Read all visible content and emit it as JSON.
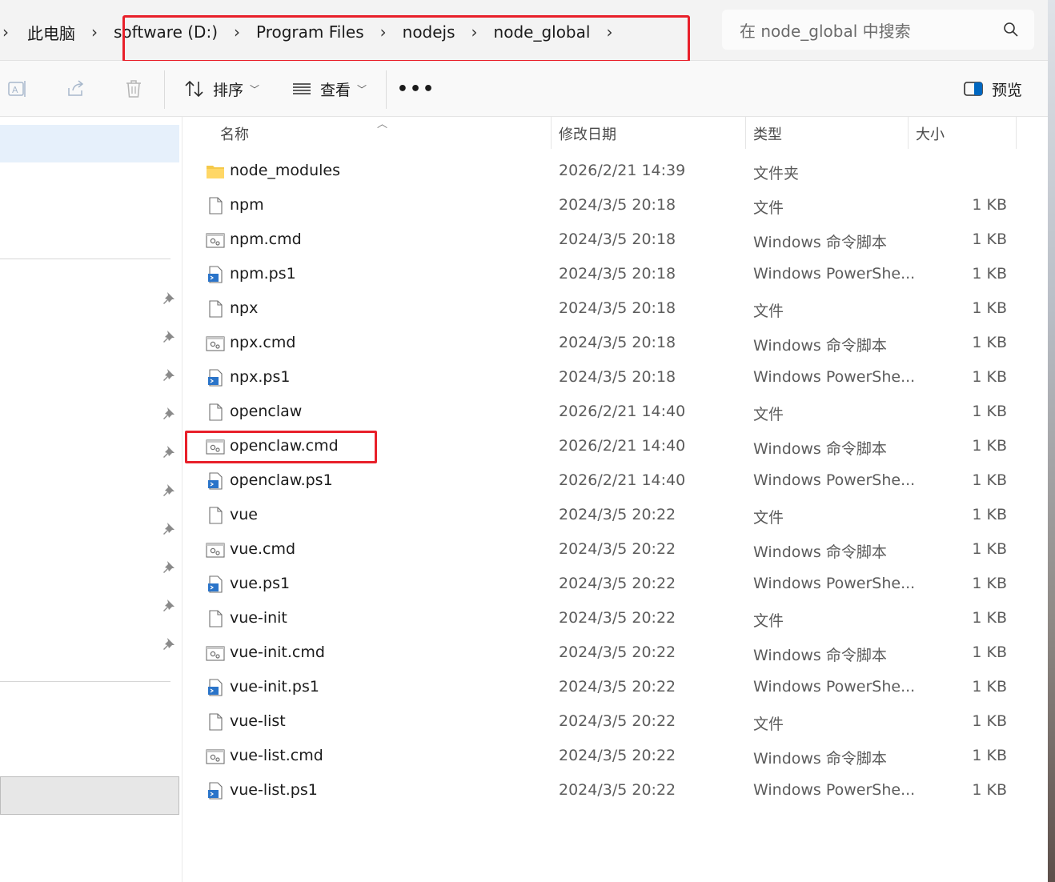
{
  "breadcrumb": {
    "items": [
      "此电脑",
      "software (D:)",
      "Program Files",
      "nodejs",
      "node_global"
    ]
  },
  "search": {
    "placeholder": "在 node_global 中搜索"
  },
  "toolbar": {
    "sort_label": "排序",
    "view_label": "查看",
    "more_label": "•••",
    "preview_label": "预览"
  },
  "columns": {
    "name": "名称",
    "date": "修改日期",
    "type": "类型",
    "size": "大小"
  },
  "files": [
    {
      "name": "node_modules",
      "date": "2026/2/21 14:39",
      "type": "文件夹",
      "size": "",
      "icon": "folder-icon"
    },
    {
      "name": "npm",
      "date": "2024/3/5 20:18",
      "type": "文件",
      "size": "1 KB",
      "icon": "file-icon"
    },
    {
      "name": "npm.cmd",
      "date": "2024/3/5 20:18",
      "type": "Windows 命令脚本",
      "size": "1 KB",
      "icon": "cmd-script-icon"
    },
    {
      "name": "npm.ps1",
      "date": "2024/3/5 20:18",
      "type": "Windows PowerShe...",
      "size": "1 KB",
      "icon": "powershell-script-icon"
    },
    {
      "name": "npx",
      "date": "2024/3/5 20:18",
      "type": "文件",
      "size": "1 KB",
      "icon": "file-icon"
    },
    {
      "name": "npx.cmd",
      "date": "2024/3/5 20:18",
      "type": "Windows 命令脚本",
      "size": "1 KB",
      "icon": "cmd-script-icon"
    },
    {
      "name": "npx.ps1",
      "date": "2024/3/5 20:18",
      "type": "Windows PowerShe...",
      "size": "1 KB",
      "icon": "powershell-script-icon"
    },
    {
      "name": "openclaw",
      "date": "2026/2/21 14:40",
      "type": "文件",
      "size": "1 KB",
      "icon": "file-icon"
    },
    {
      "name": "openclaw.cmd",
      "date": "2026/2/21 14:40",
      "type": "Windows 命令脚本",
      "size": "1 KB",
      "icon": "cmd-script-icon"
    },
    {
      "name": "openclaw.ps1",
      "date": "2026/2/21 14:40",
      "type": "Windows PowerShe...",
      "size": "1 KB",
      "icon": "powershell-script-icon"
    },
    {
      "name": "vue",
      "date": "2024/3/5 20:22",
      "type": "文件",
      "size": "1 KB",
      "icon": "file-icon"
    },
    {
      "name": "vue.cmd",
      "date": "2024/3/5 20:22",
      "type": "Windows 命令脚本",
      "size": "1 KB",
      "icon": "cmd-script-icon"
    },
    {
      "name": "vue.ps1",
      "date": "2024/3/5 20:22",
      "type": "Windows PowerShe...",
      "size": "1 KB",
      "icon": "powershell-script-icon"
    },
    {
      "name": "vue-init",
      "date": "2024/3/5 20:22",
      "type": "文件",
      "size": "1 KB",
      "icon": "file-icon"
    },
    {
      "name": "vue-init.cmd",
      "date": "2024/3/5 20:22",
      "type": "Windows 命令脚本",
      "size": "1 KB",
      "icon": "cmd-script-icon"
    },
    {
      "name": "vue-init.ps1",
      "date": "2024/3/5 20:22",
      "type": "Windows PowerShe...",
      "size": "1 KB",
      "icon": "powershell-script-icon"
    },
    {
      "name": "vue-list",
      "date": "2024/3/5 20:22",
      "type": "文件",
      "size": "1 KB",
      "icon": "file-icon"
    },
    {
      "name": "vue-list.cmd",
      "date": "2024/3/5 20:22",
      "type": "Windows 命令脚本",
      "size": "1 KB",
      "icon": "cmd-script-icon"
    },
    {
      "name": "vue-list.ps1",
      "date": "2024/3/5 20:22",
      "type": "Windows PowerShe...",
      "size": "1 KB",
      "icon": "powershell-script-icon"
    }
  ],
  "colors": {
    "highlight": "#e8202a",
    "accent": "#0067c0",
    "selection": "#e6f0fb"
  }
}
